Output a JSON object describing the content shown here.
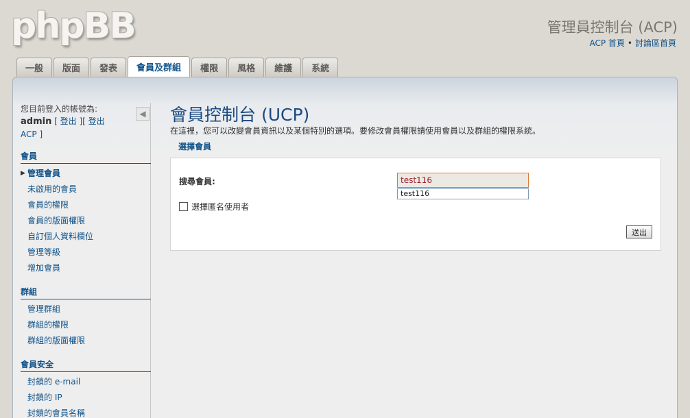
{
  "header": {
    "logo_text": "phpBB",
    "title": "管理員控制台 (ACP)",
    "links": [
      "ACP 首頁",
      "討論區首頁"
    ],
    "bullet": "•"
  },
  "tabs": [
    "一般",
    "版面",
    "發表",
    "會員及群組",
    "權限",
    "風格",
    "維護",
    "系統"
  ],
  "sidebar": {
    "login_prefix": "您目前登入的帳號為:",
    "username": "admin",
    "logout_label": "登出",
    "acp_logout_label": "登出 ACP",
    "sections": [
      {
        "title": "會員",
        "items": [
          "管理會員",
          "未啟用的會員",
          "會員的權限",
          "會員的版面權限",
          "自訂個人資料欄位",
          "管理等級",
          "增加會員"
        ]
      },
      {
        "title": "群組",
        "items": [
          "管理群組",
          "群組的權限",
          "群組的版面權限"
        ]
      },
      {
        "title": "會員安全",
        "items": [
          "封鎖的 e-mail",
          "封鎖的 IP",
          "封鎖的會員名稱"
        ]
      }
    ]
  },
  "main": {
    "title": "會員控制台 (UCP)",
    "description": "在這裡，您可以改變會員資訊以及某個特別的選項。要修改會員權限請使用會員以及群組的權限系統。",
    "legend": "選擇會員",
    "user_label": "搜尋會員:",
    "user_value": "test116",
    "suggestion": "test116",
    "anon_label": "選擇匿名使用者",
    "submit_label": "送出"
  }
}
